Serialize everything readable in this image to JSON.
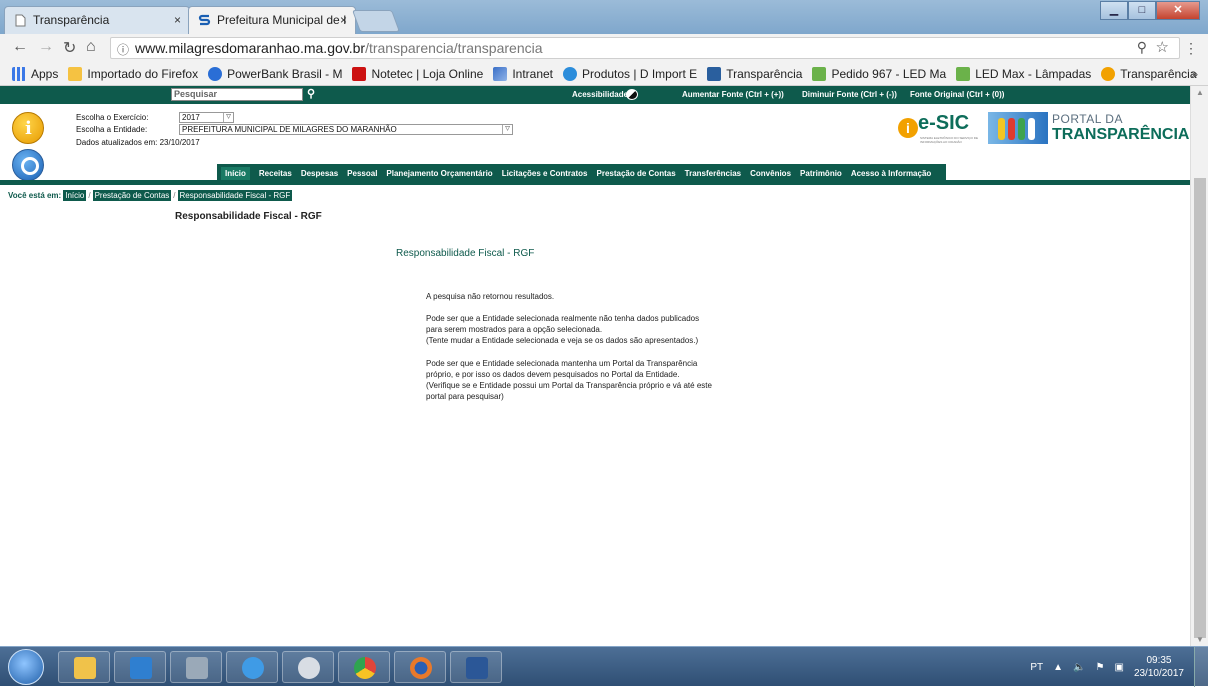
{
  "browser": {
    "tabs": [
      {
        "title": "Transparência",
        "active": false
      },
      {
        "title": "Prefeitura Municipal de I",
        "active": true
      }
    ],
    "close_glyph": "×",
    "url_host": "www.milagresdomaranhao.ma.gov.br",
    "url_path": "/transparencia/transparencia",
    "bookmarks": [
      {
        "label": "Apps",
        "icon": "apps-grid-icon",
        "color": "#3b78e7"
      },
      {
        "label": "Importado do Firefox",
        "icon": "folder-icon",
        "color": "#f5c242"
      },
      {
        "label": "PowerBank Brasil - M",
        "icon": "powerbank-icon",
        "color": "#2a6ed6"
      },
      {
        "label": "Notetec | Loja Online",
        "icon": "notetec-icon",
        "color": "#cc1111"
      },
      {
        "label": "Intranet",
        "icon": "intranet-icon",
        "color": "#3a6fc7"
      },
      {
        "label": "Produtos | D Import E",
        "icon": "dimport-icon",
        "color": "#2c8ddb"
      },
      {
        "label": "Transparência",
        "icon": "transparencia-icon",
        "color": "#2a5f9e"
      },
      {
        "label": "Pedido 967 - LED Ma",
        "icon": "box-icon",
        "color": "#6bb24a"
      },
      {
        "label": "LED Max - Lâmpadas",
        "icon": "box-icon",
        "color": "#6bb24a"
      },
      {
        "label": "Transparência",
        "icon": "info-icon",
        "color": "#f2a100"
      }
    ],
    "more_glyph": "»"
  },
  "topbar": {
    "search_placeholder": "Pesquisar",
    "accessibility_label": "Acessibilidade:",
    "increase_font": "Aumentar Fonte (Ctrl + (+))",
    "decrease_font": "Diminuir Fonte (Ctrl + (-))",
    "original_font": "Fonte Original (Ctrl + (0))"
  },
  "filters": {
    "exercise_label": "Escolha o Exercício:",
    "exercise_value": "2017",
    "entity_label": "Escolha a Entidade:",
    "entity_value": "PREFEITURA MUNICIPAL DE MILAGRES DO MARANHÃO",
    "updated_label": "Dados atualizados em: 23/10/2017"
  },
  "logos": {
    "esic": "e-SIC",
    "esic_sub": "SISTEMA ELETRÔNICO DO SERVIÇO DE INFORMAÇÕES AO CIDADÃO",
    "portal_line1": "PORTAL DA",
    "portal_line2": "TRANSPARÊNCIA"
  },
  "menu": [
    "Início",
    "Receitas",
    "Despesas",
    "Pessoal",
    "Planejamento Orçamentário",
    "Licitações e Contratos",
    "Prestação de Contas",
    "Transferências",
    "Convênios",
    "Patrimônio",
    "Acesso à Informação"
  ],
  "breadcrumb": {
    "label": "Você está em:",
    "items": [
      "Início",
      "Prestação de Contas",
      "Responsabilidade Fiscal - RGF"
    ],
    "separator": "/"
  },
  "content": {
    "page_title": "Responsabilidade Fiscal - RGF",
    "sub_title": "Responsabilidade Fiscal - RGF",
    "no_results": "A pesquisa não retornou resultados.",
    "para1_line1": "Pode ser que a Entidade selecionada realmente não tenha dados publicados",
    "para1_line2": "para serem mostrados para a opção selecionada.",
    "para1_line3": "(Tente mudar a Entidade selecionada e veja se os dados são apresentados.)",
    "para2_line1": "Pode ser que e Entidade selecionada mantenha um Portal da Transparência",
    "para2_line2": "próprio, e por isso os dados devem pesquisados no Portal da Entidade.",
    "para2_line3": "(Verifique se e Entidade possui um Portal da Transparência próprio e vá até este",
    "para2_line4": "portal para pesquisar)"
  },
  "taskbar": {
    "language": "PT",
    "time": "09:35",
    "date": "23/10/2017",
    "apps": [
      {
        "name": "explorer-icon",
        "color": "#f0c24a"
      },
      {
        "name": "outlook-icon",
        "color": "#2f7fd0"
      },
      {
        "name": "calculator-icon",
        "color": "#9aa9b8"
      },
      {
        "name": "ie-icon",
        "color": "#3f9be6"
      },
      {
        "name": "paint-icon",
        "color": "#d8dde4"
      },
      {
        "name": "chrome-icon",
        "color": "#e0453a"
      },
      {
        "name": "firefox-icon",
        "color": "#e8792b"
      },
      {
        "name": "word-icon",
        "color": "#2b5797"
      }
    ]
  },
  "colors": {
    "site_green": "#0e5a4c",
    "title_bar": "#7fa7cc"
  }
}
